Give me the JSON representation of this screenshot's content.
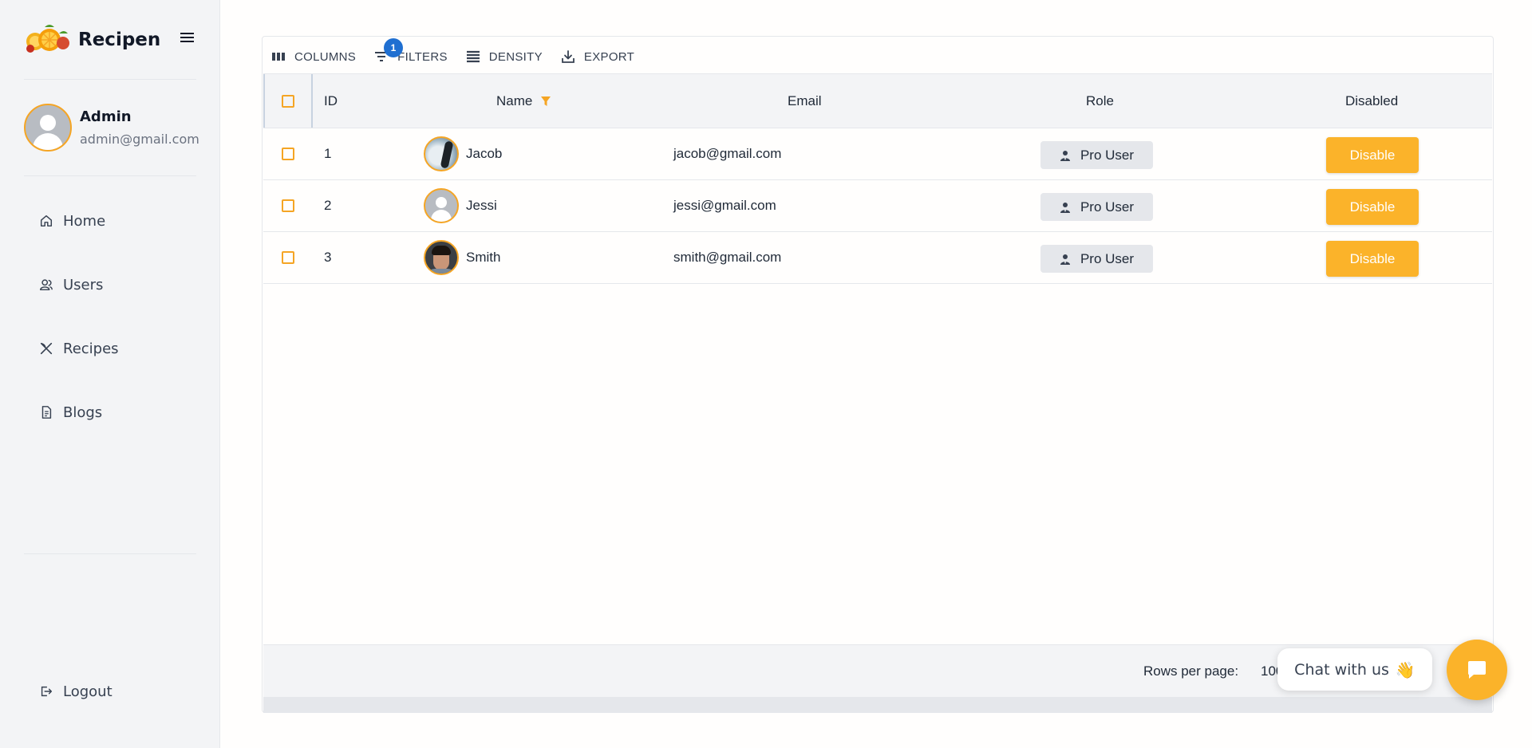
{
  "brand": {
    "name": "Recipen",
    "logo": "fruits-logo"
  },
  "profile": {
    "name": "Admin",
    "email": "admin@gmail.com"
  },
  "nav": {
    "items": [
      {
        "label": "Home",
        "icon": "home-icon"
      },
      {
        "label": "Users",
        "icon": "users-icon"
      },
      {
        "label": "Recipes",
        "icon": "utensils-icon"
      },
      {
        "label": "Blogs",
        "icon": "document-icon"
      }
    ],
    "logout": "Logout"
  },
  "toolbar": {
    "columns": "COLUMNS",
    "filters": "FILTERS",
    "filters_badge": "1",
    "density": "DENSITY",
    "export": "EXPORT"
  },
  "table": {
    "headers": {
      "id": "ID",
      "name": "Name",
      "email": "Email",
      "role": "Role",
      "disabled": "Disabled"
    },
    "rows": [
      {
        "id": "1",
        "name": "Jacob",
        "email": "jacob@gmail.com",
        "role": "Pro User",
        "action": "Disable"
      },
      {
        "id": "2",
        "name": "Jessi",
        "email": "jessi@gmail.com",
        "role": "Pro User",
        "action": "Disable"
      },
      {
        "id": "3",
        "name": "Smith",
        "email": "smith@gmail.com",
        "role": "Pro User",
        "action": "Disable"
      }
    ]
  },
  "footer": {
    "rows_per_page_label": "Rows per page:",
    "rows_per_page_value": "100"
  },
  "chat": {
    "label": "Chat with us",
    "emoji": "👋"
  },
  "colors": {
    "accent": "#fbb32a",
    "badge": "#1f6fd1",
    "sidebar_bg": "#f3f4f6"
  }
}
